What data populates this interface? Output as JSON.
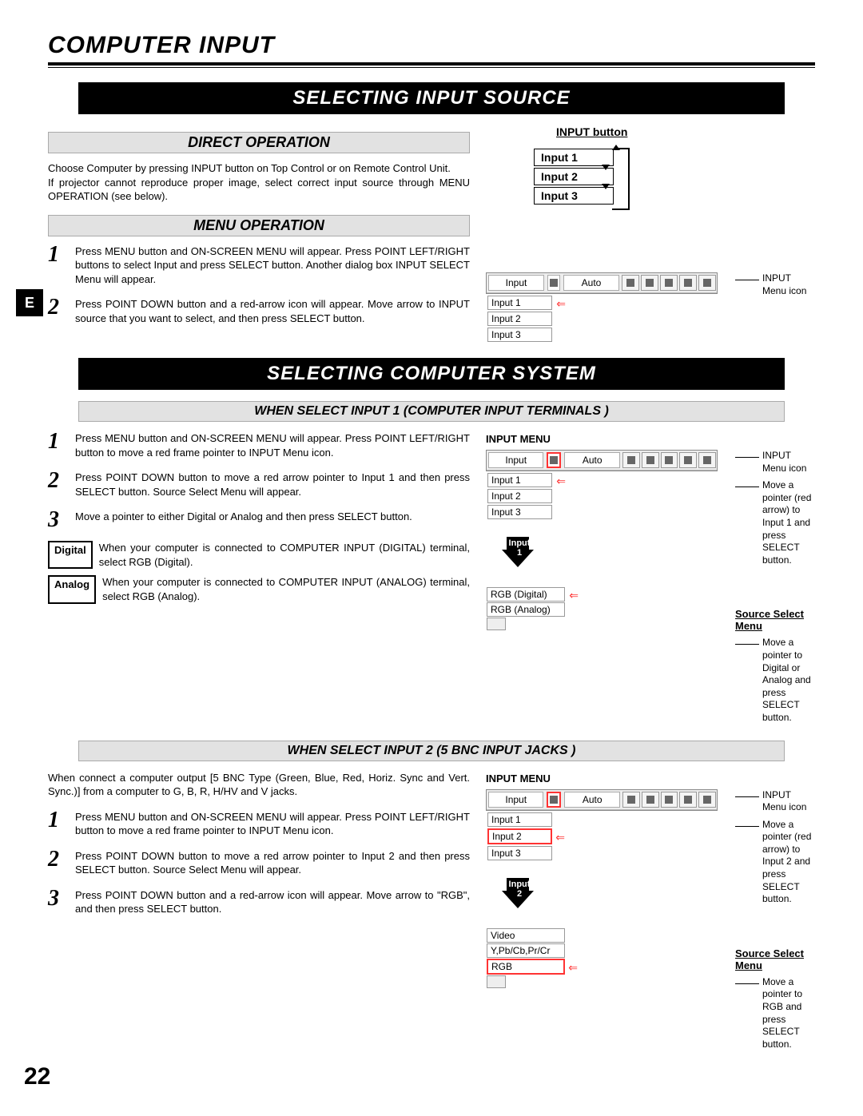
{
  "page_number": "22",
  "language_tab": "E",
  "heading_main": "COMPUTER INPUT",
  "title1": "SELECTING INPUT SOURCE",
  "direct_op_heading": "DIRECT OPERATION",
  "direct_op_text": "Choose Computer by pressing INPUT button on Top Control or on Remote Control Unit.\nIf projector cannot reproduce proper image, select correct input source through MENU OPERATION (see below).",
  "menu_op_heading": "MENU OPERATION",
  "menu_steps": [
    "Press MENU button and ON-SCREEN MENU will appear.  Press POINT LEFT/RIGHT buttons to select Input and press  SELECT button.  Another dialog box INPUT SELECT Menu will appear.",
    "Press POINT DOWN button and a red-arrow icon will appear.  Move arrow to INPUT source that you want to select, and then press SELECT button."
  ],
  "input_button_label": "INPUT button",
  "input_button_items": [
    "Input 1",
    "Input 2",
    "Input 3"
  ],
  "osd_input_label": "Input",
  "osd_auto_label": "Auto",
  "osd_input_items": [
    "Input 1",
    "Input 2",
    "Input 3"
  ],
  "input_menu_icon_note": "INPUT Menu icon",
  "title2": "SELECTING COMPUTER SYSTEM",
  "sect_a_heading": "WHEN SELECT  INPUT 1 (COMPUTER INPUT TERMINALS )",
  "sect_a_steps": [
    "Press MENU button and ON-SCREEN MENU will appear.  Press POINT LEFT/RIGHT button to move a red frame pointer to INPUT Menu icon.",
    "Press POINT DOWN button to move a red arrow pointer to Input 1 and then press SELECT button.  Source Select Menu will appear.",
    "Move a pointer to either Digital or Analog and then press SELECT button."
  ],
  "digital_label": "Digital",
  "digital_text": "When your computer is connected to COMPUTER INPUT (DIGITAL) terminal, select RGB (Digital).",
  "analog_label": "Analog",
  "analog_text": "When your computer is connected to COMPUTER INPUT (ANALOG) terminal, select RGB (Analog).",
  "input_menu_title": "INPUT MENU",
  "sect_a_note1": "INPUT Menu icon",
  "sect_a_note2": "Move a pointer (red arrow) to Input 1 and press SELECT button.",
  "sect_a_arrow_label": "Input 1",
  "source_select_title": "Source Select Menu",
  "sect_a_sources": [
    "RGB (Digital)",
    "RGB (Analog)"
  ],
  "sect_a_source_note": "Move a pointer to Digital or Analog and press SELECT button.",
  "sect_b_heading": "WHEN SELECT INPUT 2 (5 BNC INPUT JACKS )",
  "sect_b_intro": "When connect a computer output [5 BNC Type (Green, Blue, Red, Horiz. Sync and Vert. Sync.)] from a computer to G, B, R, H/HV and V jacks.",
  "sect_b_steps": [
    "Press MENU button and ON-SCREEN MENU will appear.  Press POINT LEFT/RIGHT button to move a red frame pointer to INPUT Menu icon.",
    "Press POINT DOWN button to move a red arrow pointer to Input 2 and then press SELECT button.  Source Select Menu will appear.",
    "Press POINT DOWN button and a red-arrow icon will appear.  Move arrow to \"RGB\", and then press SELECT button."
  ],
  "sect_b_note1": "INPUT Menu icon",
  "sect_b_note2": "Move a pointer (red arrow) to Input 2 and press SELECT button.",
  "sect_b_arrow_label": "Input 2",
  "sect_b_sources": [
    "Video",
    "Y,Pb/Cb,Pr/Cr",
    "RGB"
  ],
  "sect_b_source_note": "Move a pointer to RGB and press SELECT button."
}
